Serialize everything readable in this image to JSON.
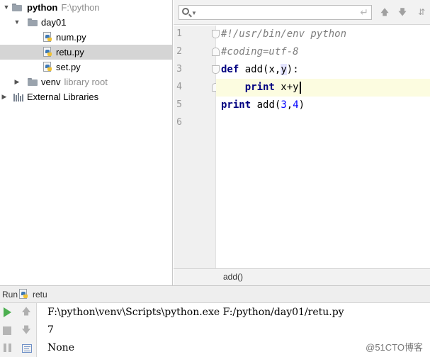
{
  "project_tree": {
    "root": {
      "name": "python",
      "path": "F:\\python"
    },
    "items": [
      {
        "label": "day01",
        "kind": "folder"
      },
      {
        "label": "num.py",
        "kind": "file"
      },
      {
        "label": "retu.py",
        "kind": "file",
        "selected": true
      },
      {
        "label": "set.py",
        "kind": "file"
      },
      {
        "label": "venv",
        "suffix": "library root",
        "kind": "folder"
      },
      {
        "label": "External Libraries",
        "kind": "library"
      }
    ]
  },
  "editor": {
    "line_numbers": [
      "1",
      "2",
      "3",
      "4",
      "5",
      "6"
    ],
    "lines": {
      "l1": "#!/usr/bin/env python",
      "l2": "#coding=utf-8",
      "l3_kw": "def",
      "l3_a": " add(",
      "l3_x": "x",
      "l3_b": ",",
      "l3_y": "y",
      "l3_c": "):",
      "l4_indent": "    ",
      "l4_kw": "print",
      "l4_rest": " x+y",
      "l5_kw": "print",
      "l5_a": " add(",
      "l5_n1": "3",
      "l5_b": ",",
      "l5_n2": "4",
      "l5_c": ")"
    },
    "breadcrumb": "add()"
  },
  "run": {
    "title": "Run",
    "tab": "retu",
    "output": [
      "F:\\python\\venv\\Scripts\\python.exe F:/python/day01/retu.py",
      "7",
      "None"
    ]
  },
  "watermark": "@51CTO博客",
  "colors": {
    "keyword": "#000080",
    "comment": "#808080",
    "number": "#0000ff",
    "run_green": "#4caf50",
    "selection": "#d5d5d5"
  }
}
